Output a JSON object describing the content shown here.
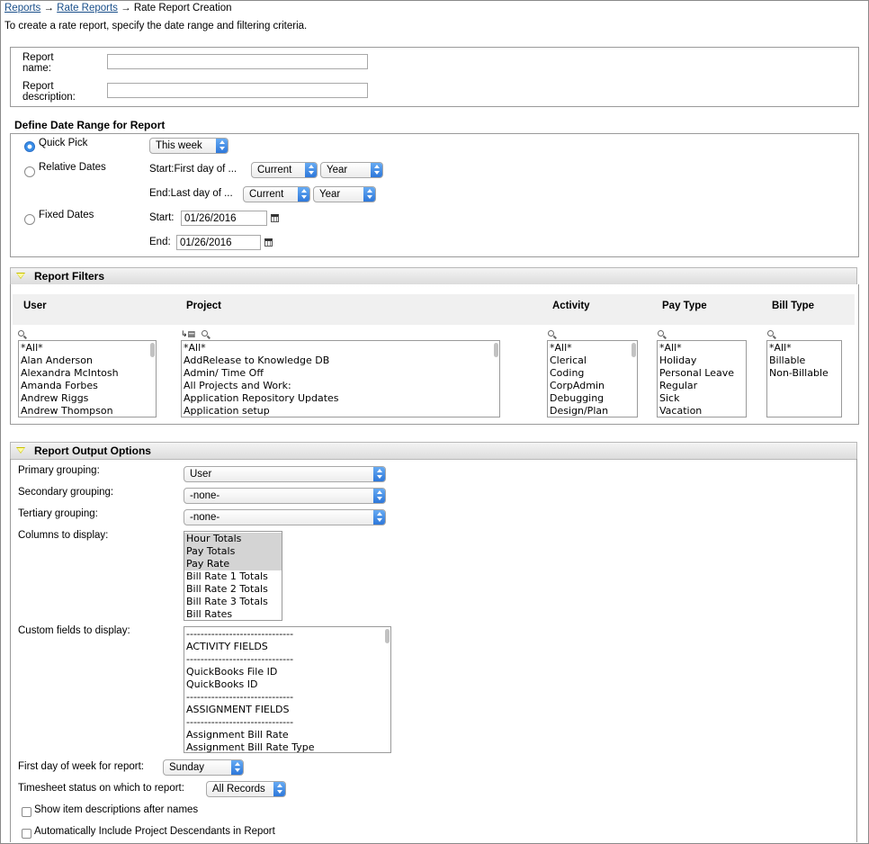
{
  "breadcrumb": {
    "link1": "Reports",
    "sep1": " → ",
    "link2": "Rate Reports",
    "sep2": " → ",
    "current": "Rate Report Creation"
  },
  "intro": "To create a rate report, specify the date range and filtering criteria.",
  "report": {
    "name_label": "Report name:",
    "name_value": "",
    "desc_label": "Report description:",
    "desc_value": ""
  },
  "date_range": {
    "title": "Define Date Range for Report",
    "quick_pick": {
      "label": "Quick Pick",
      "value": "This week",
      "checked": true
    },
    "relative": {
      "label": "Relative Dates",
      "start_label": "Start:First day of ...",
      "start_period": "Current",
      "start_unit": "Year",
      "end_label": "End:Last day of ...",
      "end_period": "Current",
      "end_unit": "Year"
    },
    "fixed": {
      "label": "Fixed Dates",
      "start_label": "Start:",
      "start_value": "01/26/2016",
      "end_label": "End:",
      "end_value": "01/26/2016"
    }
  },
  "filters": {
    "title": "Report Filters",
    "user": {
      "header": "User",
      "items": [
        "*All*",
        "Alan Anderson",
        "Alexandra McIntosh",
        "Amanda Forbes",
        "Andrew Riggs",
        "Andrew Thompson"
      ]
    },
    "project": {
      "header": "Project",
      "items": [
        "*All*",
        "AddRelease to Knowledge DB",
        "Admin/ Time Off",
        "All Projects and Work:",
        "Application Repository Updates",
        "Application setup"
      ]
    },
    "activity": {
      "header": "Activity",
      "items": [
        "*All*",
        "Clerical",
        "Coding",
        "CorpAdmin",
        "Debugging",
        "Design/Plan"
      ]
    },
    "pay_type": {
      "header": "Pay Type",
      "items": [
        "*All*",
        "Holiday",
        "Personal Leave",
        "Regular",
        "Sick",
        "Vacation"
      ]
    },
    "bill_type": {
      "header": "Bill Type",
      "items": [
        "*All*",
        "Billable",
        "Non-Billable"
      ]
    }
  },
  "output": {
    "title": "Report Output Options",
    "primary_label": "Primary grouping:",
    "primary_value": "User",
    "secondary_label": "Secondary grouping:",
    "secondary_value": "-none-",
    "tertiary_label": "Tertiary grouping:",
    "tertiary_value": "-none-",
    "columns_label": "Columns to display:",
    "columns": [
      {
        "label": "Hour Totals",
        "selected": true
      },
      {
        "label": "Pay Totals",
        "selected": true
      },
      {
        "label": "Pay Rate",
        "selected": true
      },
      {
        "label": "Bill Rate 1 Totals",
        "selected": false
      },
      {
        "label": "Bill Rate 2 Totals",
        "selected": false
      },
      {
        "label": "Bill Rate 3 Totals",
        "selected": false
      },
      {
        "label": "Bill Rates",
        "selected": false
      }
    ],
    "custom_label": "Custom fields to display:",
    "custom": [
      "------------------------------",
      "ACTIVITY FIELDS",
      "------------------------------",
      "QuickBooks File ID",
      "QuickBooks ID",
      "------------------------------",
      "ASSIGNMENT FIELDS",
      "------------------------------",
      "Assignment Bill Rate",
      "Assignment Bill Rate Type"
    ],
    "week_label": "First day of week for report:",
    "week_value": "Sunday",
    "status_label": "Timesheet status on which to report:",
    "status_value": "All Records",
    "show_desc_label": "Show item descriptions after names",
    "include_desc_label": "Automatically Include Project Descendants in Report"
  }
}
